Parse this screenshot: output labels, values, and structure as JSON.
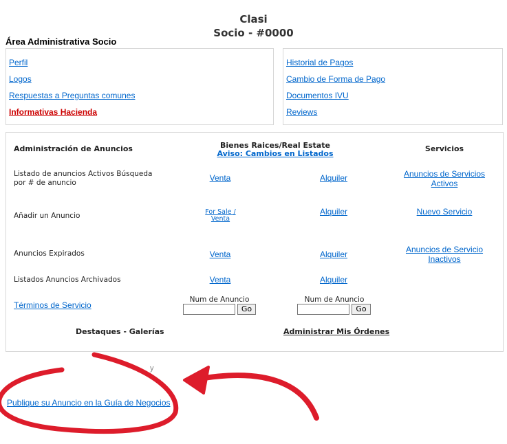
{
  "header": {
    "title": "Clasi",
    "subtitle": "Socio - #0000"
  },
  "area_title": "Área Administrativa Socio",
  "left_links": [
    "Perfil",
    "Logos",
    "Respuestas a Preguntas comunes",
    "Informativas Hacienda"
  ],
  "right_links": [
    "Historial de Pagos",
    "Cambio de Forma de Pago",
    "Documentos IVU",
    "Reviews"
  ],
  "colors": {
    "link": "#0066cc",
    "highlight_link": "#cc0000",
    "annotation": "#dd1c2b"
  },
  "panel": {
    "col_admin": "Administración de Anuncios",
    "col_realestate": "Bienes Raices/Real Estate",
    "realestate_notice": "Aviso: Cambios en Listados",
    "col_services": "Servicios",
    "rows": [
      {
        "label": "Listado de anuncios Activos Búsqueda por # de anuncio",
        "sale": "Venta",
        "rent": "Alquiler",
        "service": "Anuncios de Servicios Activos"
      },
      {
        "label": "Añadir un Anuncio",
        "sale": "For Sale / Venta",
        "rent": "Alquiler",
        "service": "Nuevo Servicio"
      },
      {
        "label": "Anuncios Expirados",
        "sale": "Venta",
        "rent": "Alquiler",
        "service": "Anuncios de Servicio Inactivos"
      },
      {
        "label": "Listados Anuncios Archivados",
        "sale": "Venta",
        "rent": "Alquiler",
        "service": ""
      }
    ],
    "terms": "Términos de Servicio",
    "num_label": "Num de Anuncio",
    "go_label": "Go",
    "highlights": "Destaques - Galerías",
    "orders": "Administrar Mis Órdenes"
  },
  "stray_mark": "y",
  "guide_link": "Publique su Anuncio en la Guía de Negocios",
  "annotation": {
    "shape": "circle-with-arrow",
    "color": "#dd1c2b"
  }
}
